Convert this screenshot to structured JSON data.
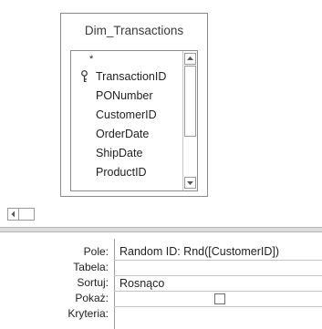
{
  "table": {
    "title": "Dim_Transactions",
    "star": "*",
    "fields": [
      "TransactionID",
      "PONumber",
      "CustomerID",
      "OrderDate",
      "ShipDate",
      "ProductID"
    ]
  },
  "grid": {
    "labels": {
      "field": "Pole:",
      "table": "Tabela:",
      "sort": "Sortuj:",
      "show": "Pokaż:",
      "criteria": "Kryteria:"
    },
    "column": {
      "field": "Random ID: Rnd([CustomerID])",
      "table": "",
      "sort": "Rosnąco",
      "show": false,
      "criteria": ""
    }
  },
  "icons": {
    "primary_key": "key-icon",
    "scroll_up": "arrow-up-icon",
    "scroll_down": "arrow-down-icon",
    "scroll_left": "arrow-left-icon"
  }
}
